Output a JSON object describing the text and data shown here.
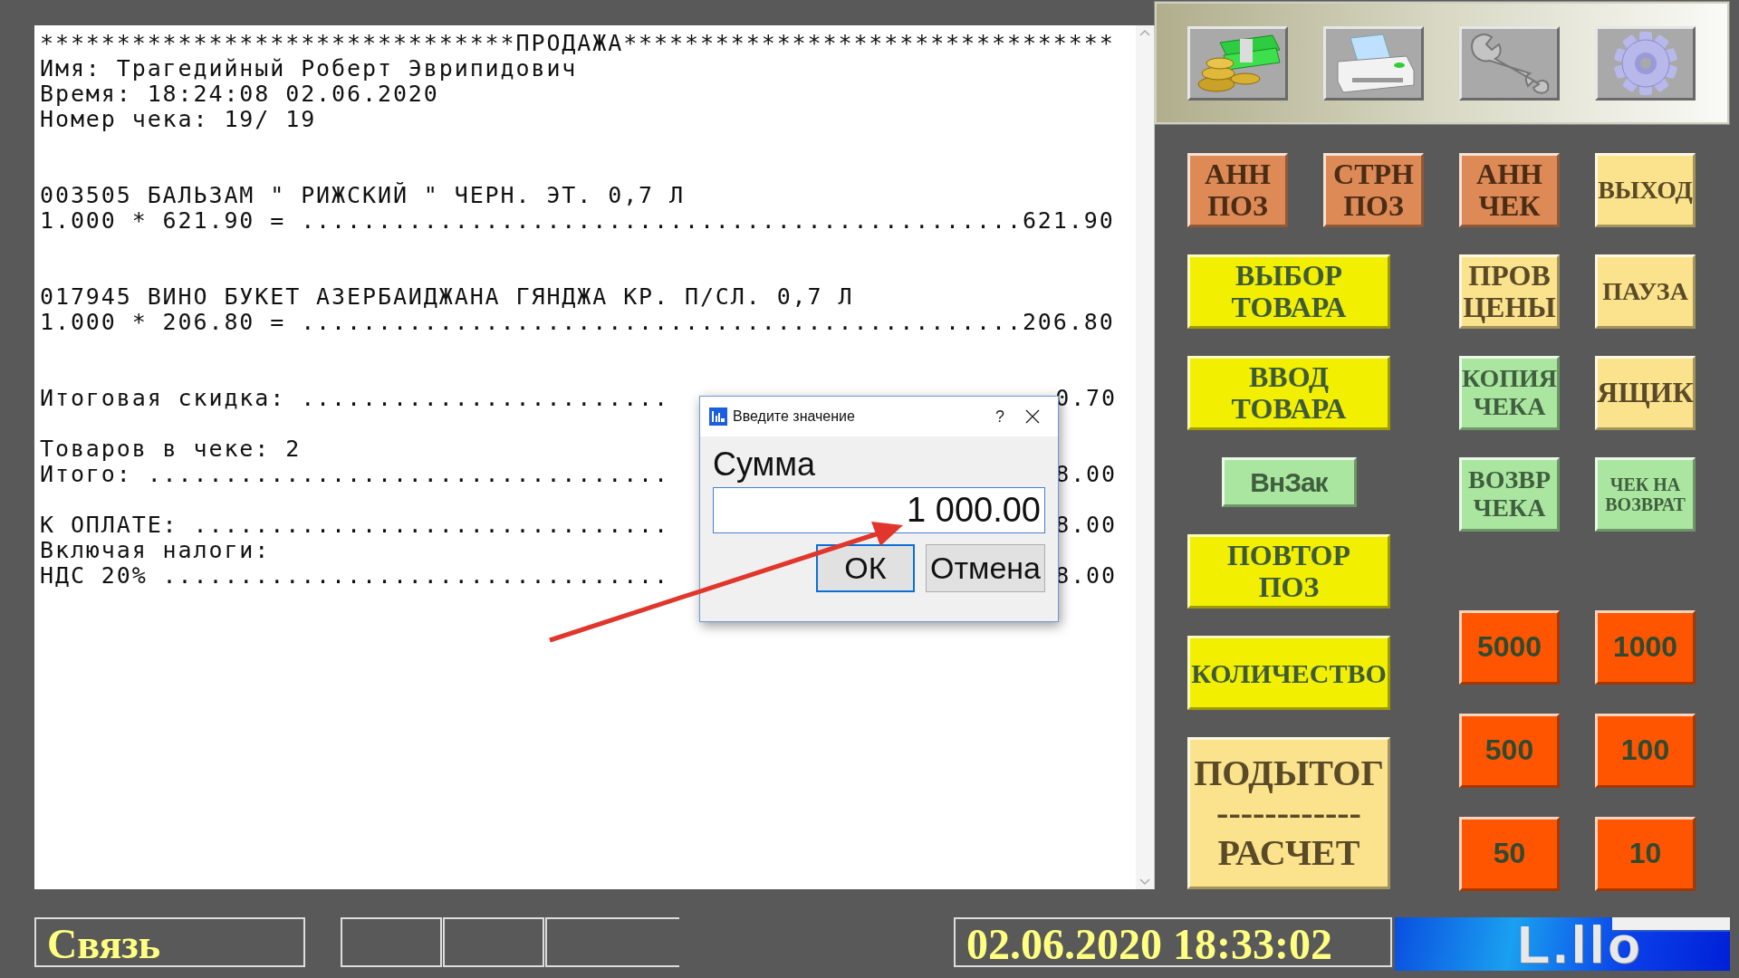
{
  "receipt": {
    "header": [
      "*******************************ПРОДАЖА********************************",
      "Имя: Трагедийный Роберт Эврипидович",
      "Время: 18:24:08 02.06.2020",
      "Номер чека: 19/ 19"
    ],
    "items": [
      {
        "name": "003505 БАЛЬЗАМ \" РИЖСКИЙ \" ЧЕРН. ЭТ. 0,7 Л",
        "calc": "1.000 * 621.90 = ...............................................621.90"
      },
      {
        "name": "017945 ВИНО БУКЕТ АЗЕРБАИДЖАНА ГЯНДЖА КР. П/СЛ. 0,7 Л",
        "calc": "1.000 * 206.80 = ...............................................206.80"
      }
    ],
    "summary": [
      [
        {
          "text": "Итоговая скидка: ........................",
          "tail": "0.70"
        }
      ],
      [
        {
          "text": "Товаров в чеке: 2"
        },
        {
          "text": "Итого: ..................................",
          "tail": "8.00"
        }
      ],
      [
        {
          "text": "К ОПЛАТЕ: ...............................",
          "tail": "8.00"
        },
        {
          "text": "Включая налоги:"
        },
        {
          "text": "НДС 20% .................................",
          "tail": "8.00"
        }
      ]
    ]
  },
  "dialog": {
    "title": "Введите значение",
    "help": "?",
    "label": "Сумма",
    "value": "1 000.00",
    "buttons": [
      {
        "label": "ОК",
        "focused": true
      },
      {
        "label": "Отмена",
        "focused": false
      }
    ]
  },
  "toolbar": [
    {
      "kind": "cash"
    },
    {
      "kind": "printer"
    },
    {
      "kind": "wrench"
    },
    {
      "kind": "gear"
    }
  ],
  "left_rows": [
    [
      {
        "lines": [
          "АНН",
          "ПОЗ"
        ],
        "kind": "orange"
      },
      {
        "lines": [
          "СТРН",
          "ПОЗ"
        ],
        "kind": "orange"
      }
    ],
    [
      {
        "lines": [
          "ВЫБОР",
          "ТОВАРА"
        ],
        "kind": "wide"
      }
    ],
    [
      {
        "lines": [
          "ВВОД",
          "ТОВАРА"
        ],
        "kind": "wide"
      }
    ],
    [
      {
        "lines": [
          "ВнЗак"
        ],
        "kind": "short"
      }
    ],
    [
      {
        "lines": [
          "ПОВТОР",
          "ПОЗ"
        ],
        "kind": "wide"
      }
    ],
    [
      {
        "lines": [
          "КОЛИЧЕСТВО"
        ],
        "kind": "wide"
      }
    ],
    [
      {
        "lines": [
          "ПОДЫТОГ",
          "------------",
          "РАСЧЕТ"
        ],
        "kind": "tall"
      }
    ]
  ],
  "right_rows": [
    [
      {
        "lines": [
          "АНН",
          "ЧЕК"
        ],
        "kind": "orange"
      },
      {
        "lines": [
          "ВЫХОД"
        ],
        "kind": "pale"
      }
    ],
    [
      {
        "lines": [
          "ПРОВ",
          "ЦЕНЫ"
        ],
        "kind": "pale"
      },
      {
        "lines": [
          "ПАУЗА"
        ],
        "kind": "pale"
      }
    ],
    [
      {
        "lines": [
          "КОПИЯ",
          "ЧЕКА"
        ],
        "kind": "green"
      },
      {
        "lines": [
          "ЯЩИК"
        ],
        "kind": "pale"
      }
    ],
    [
      {
        "lines": [
          "ВОЗВР",
          "ЧЕКА"
        ],
        "kind": "green"
      },
      {
        "lines": [
          "ЧЕК НА",
          "ВОЗВРАТ"
        ],
        "kind": "green"
      }
    ]
  ],
  "cash_buttons": [
    "5000",
    "1000",
    "500",
    "100",
    "50",
    "10"
  ],
  "status_bar": {
    "connection": "Связь",
    "datetime": "02.06.2020 18:33:02",
    "logo": "L.llo"
  }
}
